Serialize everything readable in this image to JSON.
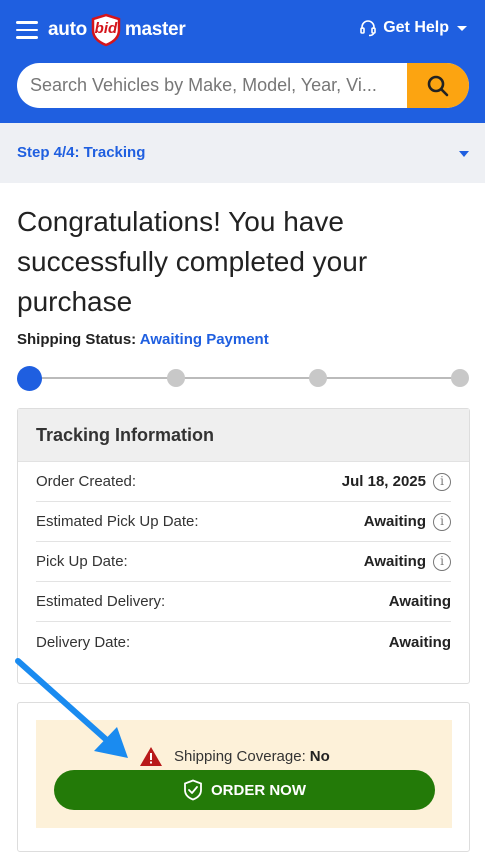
{
  "header": {
    "logo": {
      "part1": "auto",
      "part2": "bid",
      "part3": "master"
    },
    "help_label": "Get Help",
    "search_placeholder": "Search Vehicles by Make, Model, Year, Vi..."
  },
  "step": {
    "label": "Step 4/4: Tracking"
  },
  "page": {
    "title": "Congratulations! You have successfully completed your purchase",
    "shipping_status_label": "Shipping Status:",
    "shipping_status_value": "Awaiting Payment",
    "progress": {
      "current_step": 1,
      "total_steps": 4
    }
  },
  "tracking": {
    "heading": "Tracking Information",
    "rows": [
      {
        "label": "Order Created:",
        "value": "Jul 18, 2025",
        "info": true
      },
      {
        "label": "Estimated Pick Up Date:",
        "value": "Awaiting",
        "info": true
      },
      {
        "label": "Pick Up Date:",
        "value": "Awaiting",
        "info": true
      },
      {
        "label": "Estimated Delivery:",
        "value": "Awaiting",
        "info": false
      },
      {
        "label": "Delivery Date:",
        "value": "Awaiting",
        "info": false
      }
    ]
  },
  "coverage": {
    "label": "Shipping Coverage:",
    "value": "No",
    "button_label": "ORDER NOW"
  },
  "colors": {
    "brand_blue": "#1f5fe0",
    "search_button": "#fca411",
    "order_button": "#237a08",
    "coverage_bg": "#fdf1d9",
    "warning_red": "#b81a1a"
  },
  "icons": [
    "menu-icon",
    "headset-icon",
    "search-icon",
    "info-icon",
    "warning-icon",
    "shield-check-icon",
    "annotation-arrow"
  ]
}
